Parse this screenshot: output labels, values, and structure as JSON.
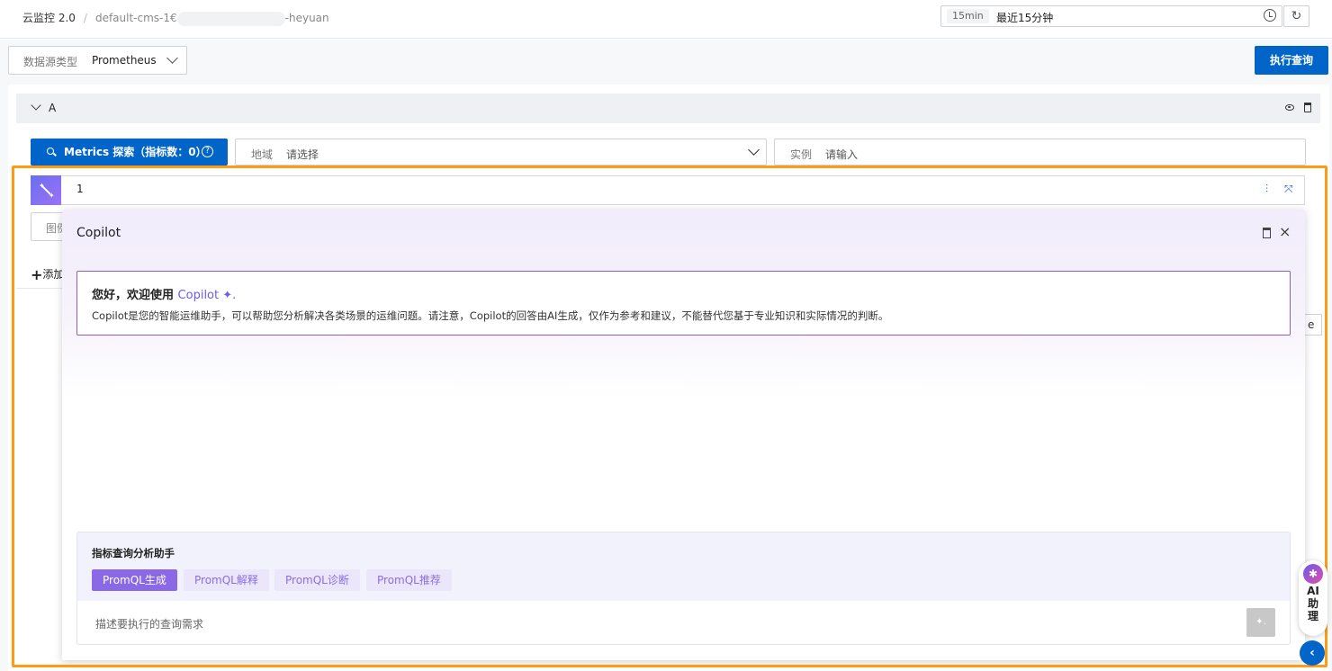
{
  "header": {
    "product": "云监控 2.0",
    "separator": "/",
    "workspace_prefix": "default-cms-1€",
    "workspace_suffix": "-heyuan",
    "time_range_tag": "15min",
    "time_range_label": "最近15分钟",
    "refresh_icon": "↻"
  },
  "toolbar": {
    "datasource_label": "数据源类型",
    "datasource_value": "Prometheus",
    "run_button": "执行查询"
  },
  "query": {
    "name": "A",
    "metrics_button": "Metrics 探索（指标数：0）",
    "help_icon": "?",
    "region_label": "地域",
    "region_placeholder": "请选择",
    "instance_label": "实例",
    "instance_placeholder": "请输入",
    "promql_value": "1"
  },
  "underlay": {
    "input_label": "图例",
    "add_label": "添加",
    "right_button": "e"
  },
  "copilot": {
    "title": "Copilot",
    "close_icon": "×",
    "welcome_title": "您好，欢迎使用",
    "welcome_brand": "Copilot ✦.",
    "welcome_desc": "Copilot是您的智能运维助手，可以帮助您分析解决各类场景的运维问题。请注意，Copilot的回答由AI生成，仅作为参考和建议，不能替代您基于专业知识和实际情况的判断。",
    "assistant_title": "指标查询分析助手",
    "chips": [
      "PromQL生成",
      "PromQL解释",
      "PromQL诊断",
      "PromQL推荐"
    ],
    "input_placeholder": "描述要执行的查询需求",
    "send_icon": "✦."
  },
  "ai_assistant": {
    "label": "AI助理",
    "logo_icon": "✱",
    "collapse_icon": "‹"
  },
  "colors": {
    "primary": "#0064c8",
    "highlight_frame": "#ff9a14",
    "copilot_accent": "#8a68e6"
  }
}
